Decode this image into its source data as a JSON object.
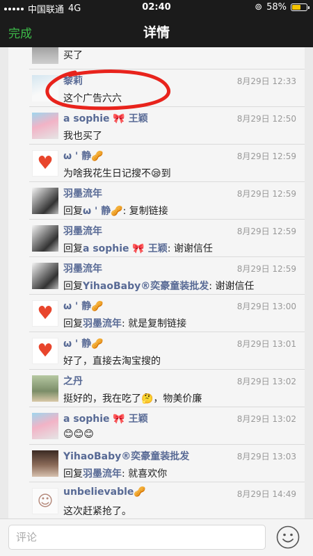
{
  "status_bar": {
    "carrier": "中国联通",
    "network": "4G",
    "time": "02:40",
    "battery": "58%",
    "battery_level": 0.58
  },
  "navbar": {
    "done_label": "完成",
    "title": "详情"
  },
  "comments": [
    {
      "avatar": "av-top",
      "name": "",
      "time": "",
      "message": "买了"
    },
    {
      "avatar": "av-lili",
      "name": "黎莉",
      "time": "8月29日 12:33",
      "message": "这个广告六六"
    },
    {
      "avatar": "av-sophie",
      "name": "a sophie 🎀 王颖",
      "time": "8月29日 12:50",
      "message": "我也买了"
    },
    {
      "avatar": "av-heart",
      "name": "ω ' 静🥜",
      "time": "8月29日 12:59",
      "message": "为啥我花生日记搜不😪到"
    },
    {
      "avatar": "av-photo",
      "name": "羽墨流年",
      "time": "8月29日 12:59",
      "message": "",
      "reply_prefix": "回复",
      "reply_to": "ω ' 静🥜",
      "reply_text": ": 复制链接"
    },
    {
      "avatar": "av-photo",
      "name": "羽墨流年",
      "time": "8月29日 12:59",
      "message": "",
      "reply_prefix": "回复",
      "reply_to": "a sophie 🎀 王颖",
      "reply_text": ": 谢谢信任"
    },
    {
      "avatar": "av-photo",
      "name": "羽墨流年",
      "time": "8月29日 12:59",
      "message": "",
      "reply_prefix": "回复",
      "reply_to": "YihaoBaby®奕豪童装批发",
      "reply_text": ": 谢谢信任"
    },
    {
      "avatar": "av-heart",
      "name": "ω ' 静🥜",
      "time": "8月29日 13:00",
      "message": "",
      "reply_prefix": "回复",
      "reply_to": "羽墨流年",
      "reply_text": ": 就是复制链接"
    },
    {
      "avatar": "av-heart",
      "name": "ω ' 静🥜",
      "time": "8月29日 13:01",
      "message": "好了，直接去淘宝搜的"
    },
    {
      "avatar": "av-zhidan",
      "name": "之丹",
      "time": "8月29日 13:02",
      "message": "挺好的，我在吃了🤔，物美价廉"
    },
    {
      "avatar": "av-sophie",
      "name": "a sophie 🎀 王颖",
      "time": "8月29日 13:02",
      "message": "😊😊😊"
    },
    {
      "avatar": "av-yihao",
      "name": "YihaoBaby®奕豪童装批发",
      "time": "8月29日 13:03",
      "message": "",
      "reply_prefix": "回复",
      "reply_to": "羽墨流年",
      "reply_text": ": 就喜欢你"
    },
    {
      "avatar": "av-unbel",
      "name": "unbelievable🥜",
      "time": "8月29日 14:49",
      "message": "这次赶紧抢了。"
    }
  ],
  "bottom_bar": {
    "comment_placeholder": "评论",
    "emoji_icon": "smiley-face-icon"
  },
  "colors": {
    "accent": "#3dbb49",
    "link": "#586a95",
    "annotation": "#e8231c",
    "topbar": "#1b1b1b"
  }
}
